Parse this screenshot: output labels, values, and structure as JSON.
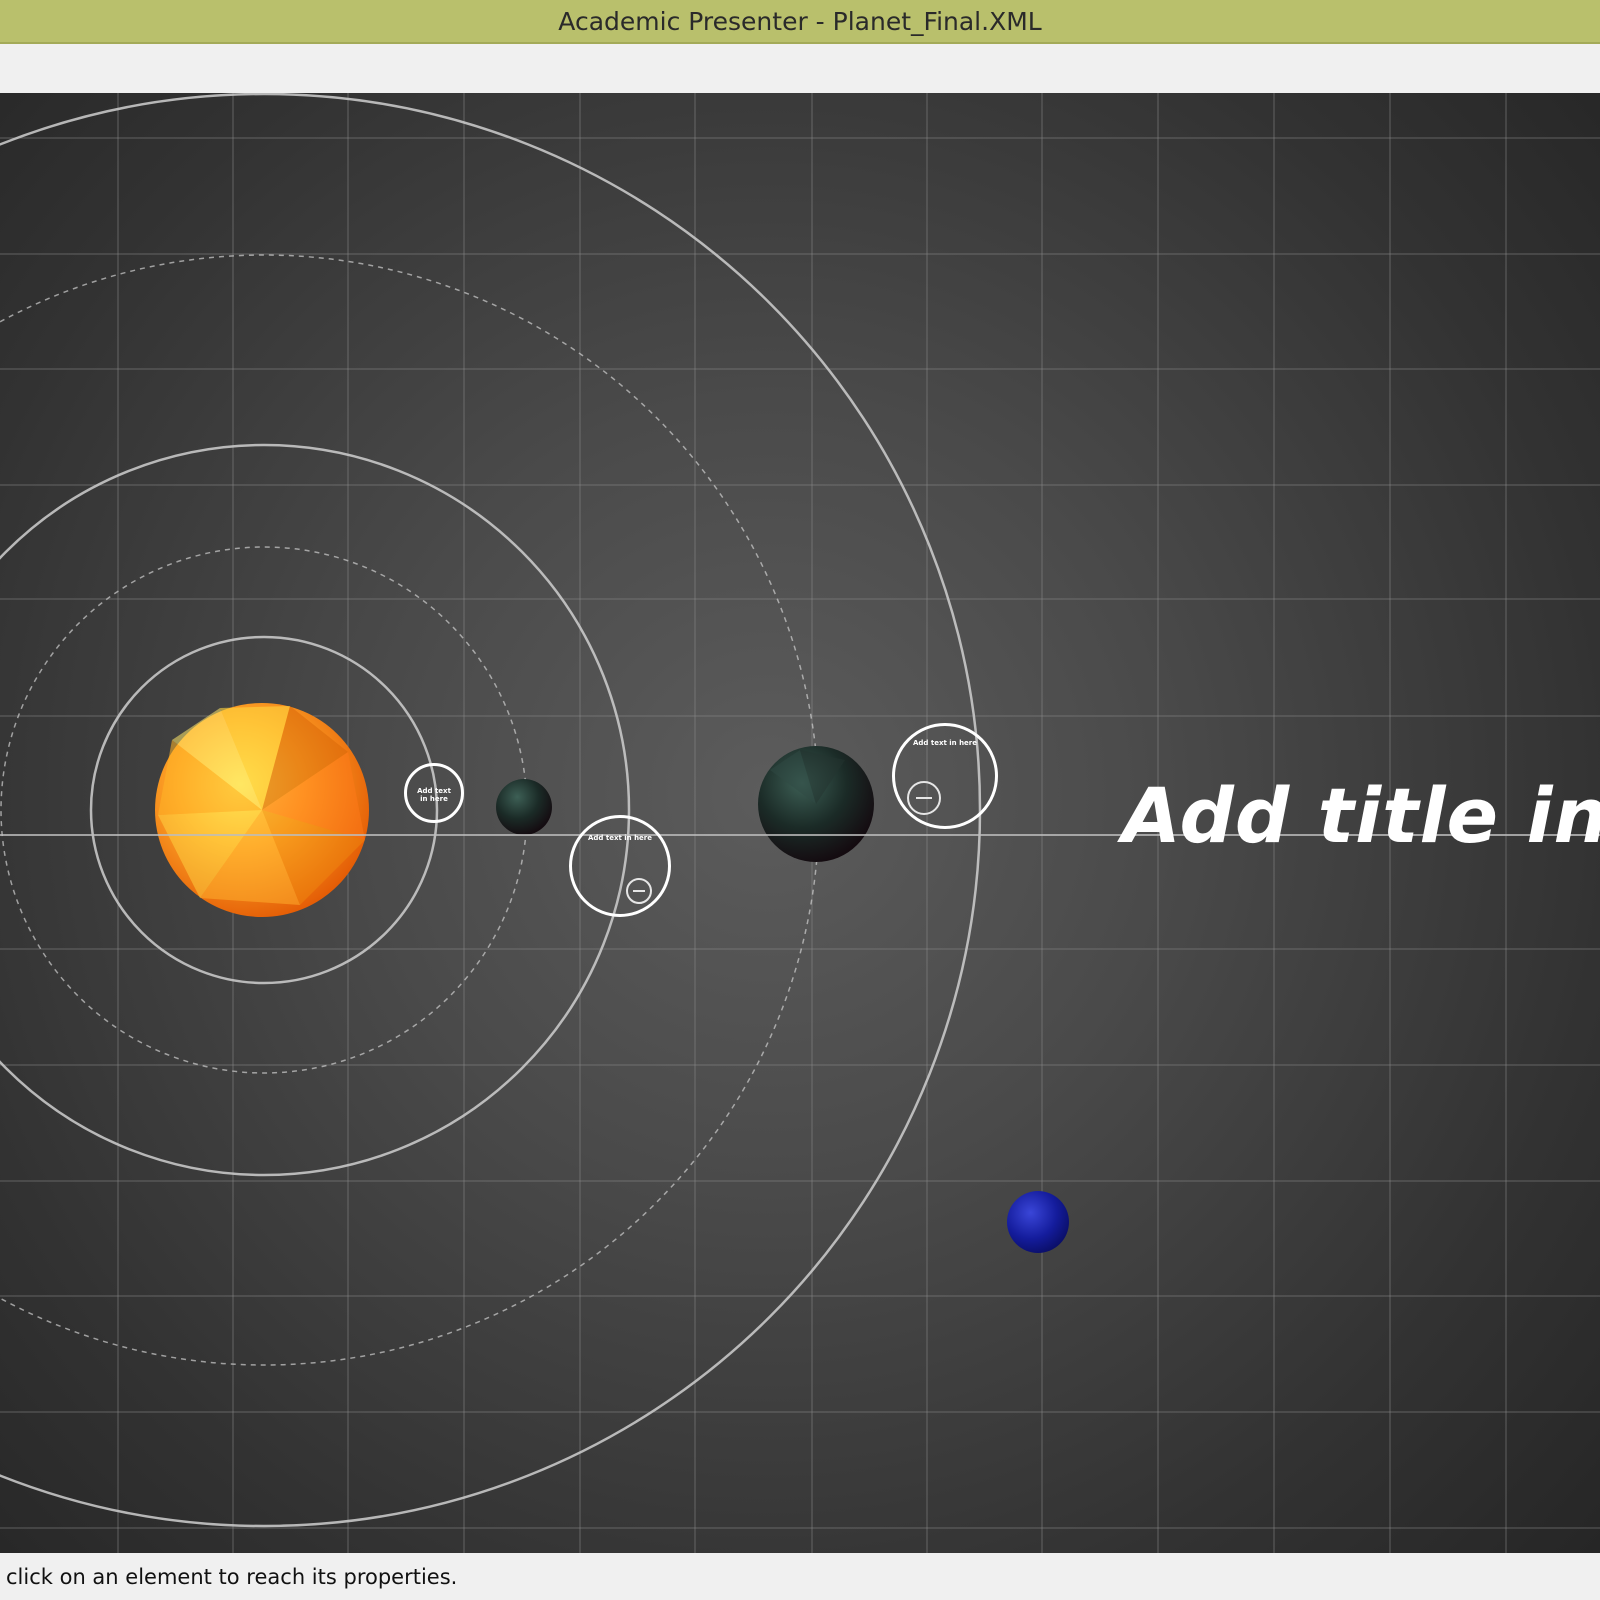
{
  "window": {
    "title": "Academic Presenter - Planet_Final.XML"
  },
  "slide": {
    "title": "Add title in h"
  },
  "notes": [
    {
      "text": "Add text in here"
    },
    {
      "text": "Add text in here"
    },
    {
      "text": "Add text in here"
    }
  ],
  "status": {
    "message": "click on an element to reach its properties."
  },
  "colors": {
    "titlebar": "#b9c06c",
    "canvas_background": "#4a4a4a",
    "sun_orange": "#f5a623",
    "blue_planet": "#12188c",
    "dark_planet": "#1c2622"
  },
  "icons": [
    "sun-planet-icon",
    "dark-planet-icon",
    "blue-planet-icon",
    "minus-icon"
  ]
}
